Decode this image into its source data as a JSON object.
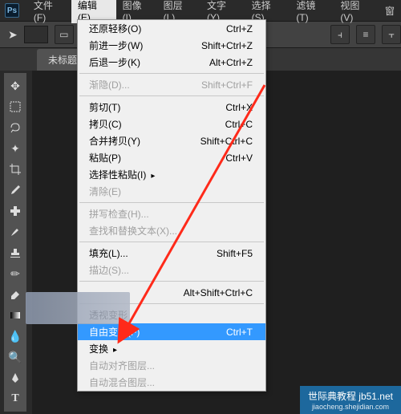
{
  "app": {
    "logo_text": "Ps"
  },
  "menubar": {
    "items": [
      {
        "label": "文件(F)"
      },
      {
        "label": "编辑(E)"
      },
      {
        "label": "图像(I)"
      },
      {
        "label": "图层(L)"
      },
      {
        "label": "文字(Y)"
      },
      {
        "label": "选择(S)"
      },
      {
        "label": "滤镜(T)"
      },
      {
        "label": "视图(V)"
      },
      {
        "label": "窗"
      }
    ]
  },
  "doc_tab": {
    "title": "未标题"
  },
  "dropdown": {
    "rows": [
      {
        "label": "还原轻移(O)",
        "shortcut": "Ctrl+Z"
      },
      {
        "label": "前进一步(W)",
        "shortcut": "Shift+Ctrl+Z"
      },
      {
        "label": "后退一步(K)",
        "shortcut": "Alt+Ctrl+Z"
      },
      {
        "sep": true
      },
      {
        "label": "渐隐(D)...",
        "shortcut": "Shift+Ctrl+F",
        "disabled": true
      },
      {
        "sep": true
      },
      {
        "label": "剪切(T)",
        "shortcut": "Ctrl+X"
      },
      {
        "label": "拷贝(C)",
        "shortcut": "Ctrl+C"
      },
      {
        "label": "合并拷贝(Y)",
        "shortcut": "Shift+Ctrl+C"
      },
      {
        "label": "粘贴(P)",
        "shortcut": "Ctrl+V"
      },
      {
        "label": "选择性粘贴(I)",
        "submenu": true
      },
      {
        "label": "清除(E)",
        "disabled": true
      },
      {
        "sep": true
      },
      {
        "label": "拼写检查(H)...",
        "disabled": true
      },
      {
        "label": "查找和替换文本(X)...",
        "disabled": true
      },
      {
        "sep": true
      },
      {
        "label": "填充(L)...",
        "shortcut": "Shift+F5"
      },
      {
        "label": "描边(S)...",
        "disabled": true
      },
      {
        "sep": true
      },
      {
        "label": "",
        "shortcut": "Alt+Shift+Ctrl+C"
      },
      {
        "sep": true
      },
      {
        "label": "透视变形"
      },
      {
        "label": "自由变换(F)",
        "shortcut": "Ctrl+T",
        "hover": true
      },
      {
        "label": "变换",
        "submenu": true
      },
      {
        "label": "自动对齐图层...",
        "disabled": true
      },
      {
        "label": "自动混合图层...",
        "disabled": true
      }
    ]
  },
  "tools": {
    "items": [
      "move-tool",
      "marquee-tool",
      "lasso-tool",
      "wand-tool",
      "crop-tool",
      "eyedropper-tool",
      "healing-tool",
      "brush-tool",
      "stamp-tool",
      "history-brush-tool",
      "eraser-tool",
      "gradient-tool",
      "blur-tool",
      "dodge-tool",
      "pen-tool",
      "type-tool"
    ]
  },
  "watermark": {
    "main": "世际典教程 jb51.net",
    "sub": "jiaocheng.shejidian.com"
  },
  "colors": {
    "accent": "#3399ff",
    "bg": "#2a2a2a",
    "panel": "#525252"
  }
}
